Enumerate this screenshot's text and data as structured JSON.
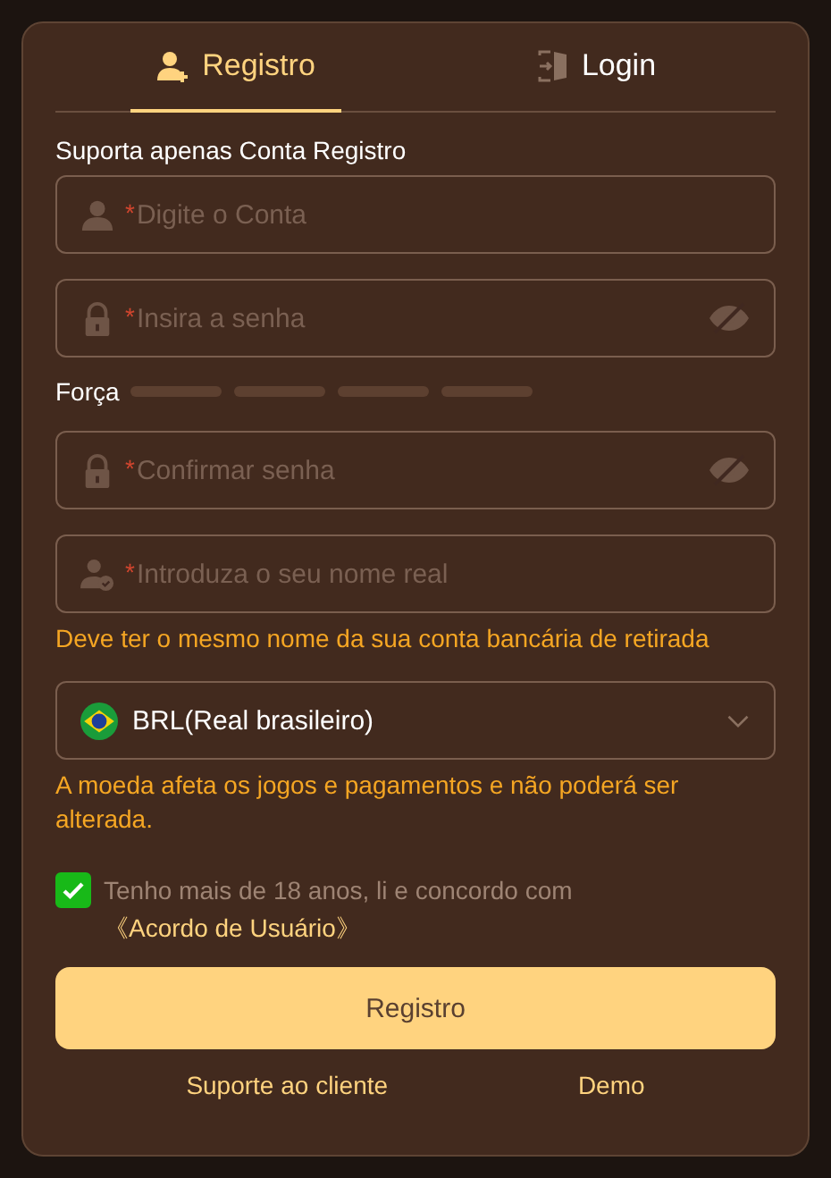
{
  "tabs": [
    {
      "label": "Registro",
      "selected": true
    },
    {
      "label": "Login",
      "selected": false
    }
  ],
  "account_note": "Suporta apenas Conta Registro",
  "fields": [
    {
      "kind": "account",
      "mark": "*",
      "placeholder": "Digite o Conta"
    },
    {
      "kind": "password",
      "mark": "*",
      "placeholder": "Insira a senha",
      "revealed": false
    },
    {
      "kind": "strength",
      "label": "Força"
    },
    {
      "kind": "password",
      "mark": "*",
      "placeholder": "Confirmar senha",
      "revealed": false
    },
    {
      "kind": "name",
      "mark": "*",
      "placeholder": "Introduza o seu nome real",
      "hint": "Deve ter o mesmo nome da sua conta bancária de retirada"
    },
    {
      "kind": "currency",
      "value": "BRL(Real brasileiro)",
      "hint": "A moeda afeta os jogos e pagamentos e não poderá ser alterada."
    }
  ],
  "agreement": {
    "checked": true,
    "text": "Tenho mais de 18 anos, li e concordo com ",
    "link": "《Acordo de Usuário》"
  },
  "submit": "Registro",
  "footer_links": [
    "Suporte ao cliente",
    "Demo"
  ]
}
